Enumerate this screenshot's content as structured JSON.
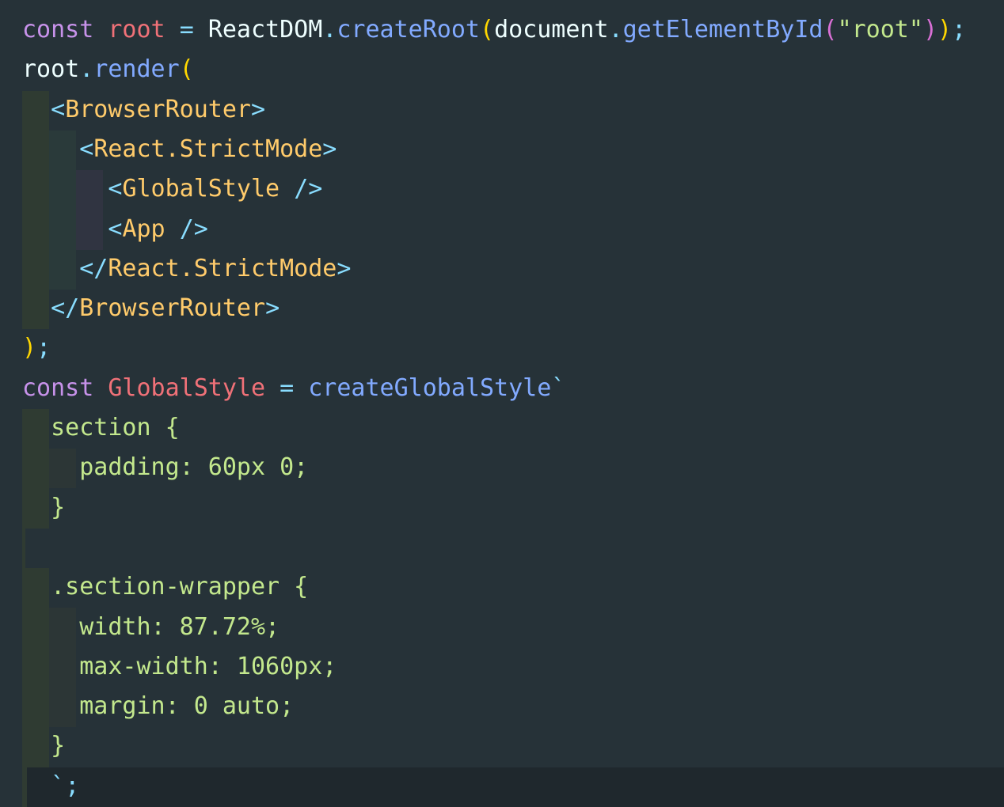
{
  "editor": {
    "language": "javascript-jsx",
    "theme_colors": {
      "background": "#263238",
      "keyword": "#c792ea",
      "variable": "#f07178",
      "operator": "#89ddff",
      "function": "#82aaff",
      "bracket": "#ffd700",
      "string": "#c3e88d",
      "tag": "#ffcb6b"
    },
    "lines": [
      {
        "tokens": [
          {
            "t": "const",
            "c": "kw"
          },
          {
            "t": " "
          },
          {
            "t": "root",
            "c": "var"
          },
          {
            "t": " "
          },
          {
            "t": "=",
            "c": "op"
          },
          {
            "t": " "
          },
          {
            "t": "ReactDOM"
          },
          {
            "t": ".",
            "c": "op"
          },
          {
            "t": "createRoot",
            "c": "fn"
          },
          {
            "t": "(",
            "c": "br1"
          },
          {
            "t": "document"
          },
          {
            "t": ".",
            "c": "op"
          },
          {
            "t": "getElementById",
            "c": "fn"
          },
          {
            "t": "(",
            "c": "br2"
          },
          {
            "t": "\"root\"",
            "c": "str"
          },
          {
            "t": ")",
            "c": "br2"
          },
          {
            "t": ")",
            "c": "br1"
          },
          {
            "t": ";",
            "c": "op"
          }
        ]
      },
      {
        "tokens": [
          {
            "t": "root"
          },
          {
            "t": ".",
            "c": "op"
          },
          {
            "t": "render",
            "c": "fn"
          },
          {
            "t": "(",
            "c": "br1"
          }
        ]
      },
      {
        "tokens": [
          {
            "t": "  "
          },
          {
            "t": "<",
            "c": "tb"
          },
          {
            "t": "BrowserRouter",
            "c": "tag"
          },
          {
            "t": ">",
            "c": "tb"
          }
        ]
      },
      {
        "tokens": [
          {
            "t": "    "
          },
          {
            "t": "<",
            "c": "tb"
          },
          {
            "t": "React.StrictMode",
            "c": "tag"
          },
          {
            "t": ">",
            "c": "tb"
          }
        ]
      },
      {
        "tokens": [
          {
            "t": "      "
          },
          {
            "t": "<",
            "c": "tb"
          },
          {
            "t": "GlobalStyle",
            "c": "tag"
          },
          {
            "t": " "
          },
          {
            "t": "/>",
            "c": "tb"
          }
        ]
      },
      {
        "tokens": [
          {
            "t": "      "
          },
          {
            "t": "<",
            "c": "tb"
          },
          {
            "t": "App",
            "c": "tag"
          },
          {
            "t": " "
          },
          {
            "t": "/>",
            "c": "tb"
          }
        ]
      },
      {
        "tokens": [
          {
            "t": "    "
          },
          {
            "t": "</",
            "c": "tb"
          },
          {
            "t": "React.StrictMode",
            "c": "tag"
          },
          {
            "t": ">",
            "c": "tb"
          }
        ]
      },
      {
        "tokens": [
          {
            "t": "  "
          },
          {
            "t": "</",
            "c": "tb"
          },
          {
            "t": "BrowserRouter",
            "c": "tag"
          },
          {
            "t": ">",
            "c": "tb"
          }
        ]
      },
      {
        "tokens": [
          {
            "t": ")",
            "c": "br1"
          },
          {
            "t": ";",
            "c": "op"
          }
        ]
      },
      {
        "tokens": [
          {
            "t": "const",
            "c": "kw"
          },
          {
            "t": " "
          },
          {
            "t": "GlobalStyle",
            "c": "var"
          },
          {
            "t": " "
          },
          {
            "t": "=",
            "c": "op"
          },
          {
            "t": " "
          },
          {
            "t": "createGlobalStyle",
            "c": "fn"
          },
          {
            "t": "`",
            "c": "op"
          }
        ]
      },
      {
        "tokens": [
          {
            "t": "  "
          },
          {
            "t": "section {",
            "c": "css"
          }
        ]
      },
      {
        "tokens": [
          {
            "t": "    "
          },
          {
            "t": "padding: 60px 0;",
            "c": "css"
          }
        ]
      },
      {
        "tokens": [
          {
            "t": "  "
          },
          {
            "t": "}",
            "c": "css"
          }
        ]
      },
      {
        "tokens": [
          {
            "t": ""
          }
        ]
      },
      {
        "tokens": [
          {
            "t": "  "
          },
          {
            "t": ".section-wrapper {",
            "c": "css"
          }
        ]
      },
      {
        "tokens": [
          {
            "t": "    "
          },
          {
            "t": "width: 87.72%;",
            "c": "css"
          }
        ]
      },
      {
        "tokens": [
          {
            "t": "    "
          },
          {
            "t": "max-width: 1060px;",
            "c": "css"
          }
        ]
      },
      {
        "tokens": [
          {
            "t": "    "
          },
          {
            "t": "margin: 0 auto;",
            "c": "css"
          }
        ]
      },
      {
        "tokens": [
          {
            "t": "  "
          },
          {
            "t": "}",
            "c": "css"
          }
        ]
      },
      {
        "tokens": [
          {
            "t": "  "
          },
          {
            "t": "`",
            "c": "op"
          },
          {
            "t": ";",
            "c": "op"
          }
        ]
      }
    ]
  }
}
